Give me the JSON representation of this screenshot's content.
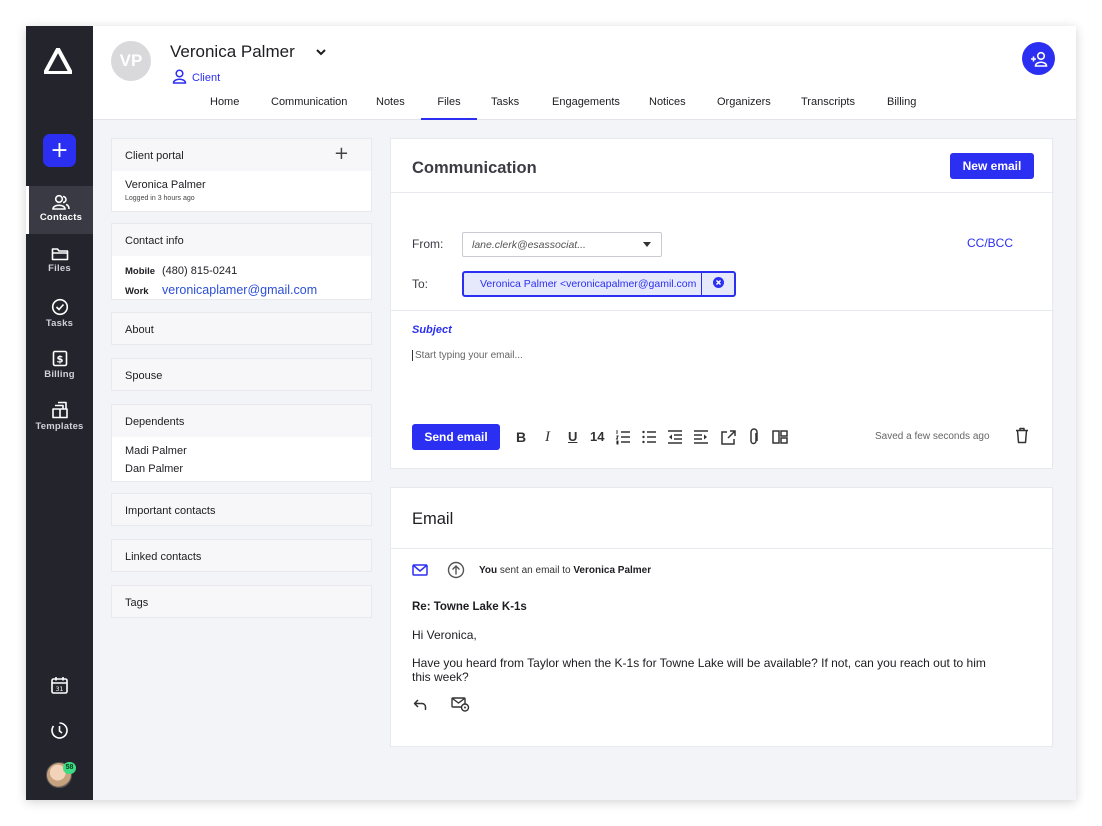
{
  "sidebar": {
    "add_label": "+",
    "items": [
      {
        "label": "Contacts",
        "icon": "contacts-icon",
        "active": true
      },
      {
        "label": "Files",
        "icon": "folder-icon"
      },
      {
        "label": "Tasks",
        "icon": "check-circle-icon"
      },
      {
        "label": "Billing",
        "icon": "dollar-icon"
      },
      {
        "label": "Templates",
        "icon": "templates-icon"
      }
    ],
    "bottom_icons": [
      "calendar-icon",
      "timer-icon"
    ],
    "avatar_badge": "58"
  },
  "header": {
    "initials": "VP",
    "client_name": "Veronica Palmer",
    "client_role": "Client",
    "tabs": [
      "Home",
      "Communication",
      "Notes",
      "Files",
      "Tasks",
      "Engagements",
      "Notices",
      "Organizers",
      "Transcripts",
      "Billing"
    ],
    "active_tab": "Files"
  },
  "left": {
    "client_portal": {
      "title": "Client portal",
      "name": "Veronica Palmer",
      "status": "Logged in 3 hours ago"
    },
    "contact_info": {
      "title": "Contact info",
      "mobile_label": "Mobile",
      "mobile": "(480) 815-0241",
      "work_label": "Work",
      "work_email": "veronicaplamer@gmail.com"
    },
    "about": "About",
    "spouse": "Spouse",
    "dependents": {
      "title": "Dependents",
      "items": [
        "Madi Palmer",
        "Dan Palmer"
      ]
    },
    "important_contacts": "Important contacts",
    "linked_contacts": "Linked contacts",
    "tags": "Tags"
  },
  "compose": {
    "title": "Communication",
    "new_email": "New email",
    "from_label": "From:",
    "from_value": "lane.clerk@esassociat...",
    "ccbcc": "CC/BCC",
    "to_label": "To:",
    "to_value": "Veronica Palmer <veronicapalmer@gamil.com",
    "subject_label": "Subject",
    "body_placeholder": "Start typing your email...",
    "send": "Send email",
    "font_size": "14",
    "saved": "Saved a few seconds ago"
  },
  "email": {
    "title": "Email",
    "event_you": "You",
    "event_action": " sent an email to ",
    "event_recipient": "Veronica Palmer",
    "subject": "Re: Towne Lake K-1s",
    "greeting": "Hi Veronica,",
    "body": "Have you heard from Taylor when the K-1s for Towne Lake will be available? If not, can you reach out to him this week?"
  },
  "colors": {
    "accent": "#2b2ff2",
    "sidebar": "#24242d"
  }
}
